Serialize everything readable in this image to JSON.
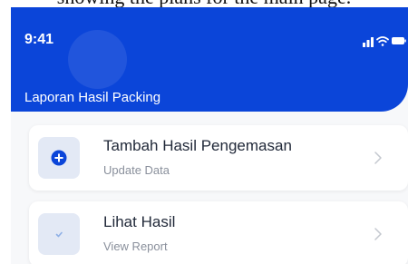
{
  "caption": "showing the plans for the main page.",
  "status_bar": {
    "time": "9:41",
    "icons": [
      "signal-icon",
      "wifi-icon",
      "battery-icon"
    ]
  },
  "header": {
    "title": "Laporan Hasil Packing",
    "background_color": "#0b45d9"
  },
  "menu": [
    {
      "title": "Tambah Hasil Pengemasan",
      "subtitle": "Update Data",
      "icon": "plus-circle-icon",
      "icon_color": "#0b45d9"
    },
    {
      "title": "Lihat Hasil",
      "subtitle": "View Report",
      "icon": "check-icon",
      "icon_color": "#8fb0e6"
    }
  ]
}
